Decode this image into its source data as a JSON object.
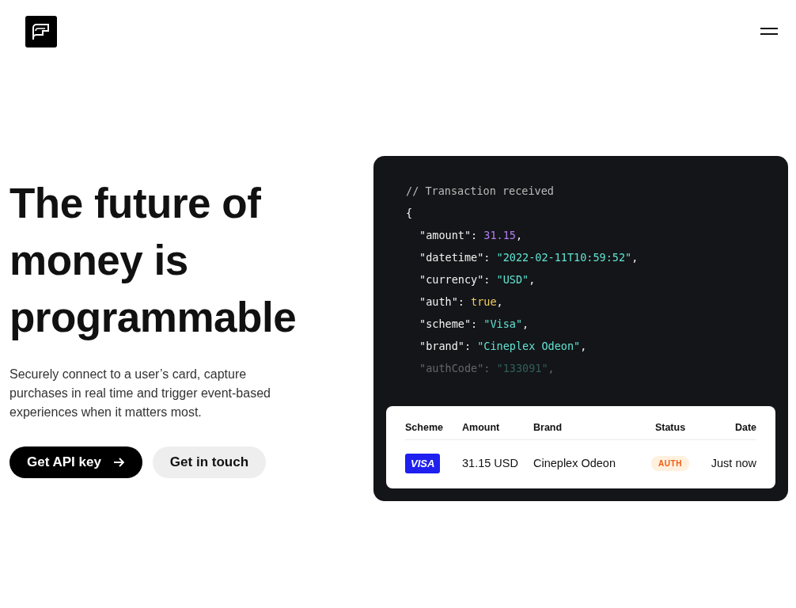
{
  "header": {
    "menu_open": false
  },
  "hero": {
    "heading": "The future of money is programmable",
    "description": "Securely connect to a user’s card, capture purchases in real time and trigger event-based experiences when it matters most.",
    "buttons": [
      {
        "label": "Get API key",
        "kind": "primary"
      },
      {
        "label": "Get in touch",
        "kind": "secondary"
      }
    ]
  },
  "code": {
    "comment": "// Transaction received",
    "open": "{",
    "fields": [
      {
        "key": "\"amount\":",
        "value": "31.15",
        "suffix": ",",
        "kind": "number",
        "faded": false
      },
      {
        "key": "\"datetime\":",
        "value": "\"2022-02-11T10:59:52\"",
        "suffix": ",",
        "kind": "string",
        "faded": false
      },
      {
        "key": "\"currency\":",
        "value": "\"USD\"",
        "suffix": ",",
        "kind": "string",
        "faded": false
      },
      {
        "key": "\"auth\":",
        "value": "true",
        "suffix": ",",
        "kind": "boolean",
        "faded": false
      },
      {
        "key": "\"scheme\":",
        "value": "\"Visa\"",
        "suffix": ",",
        "kind": "string",
        "faded": false
      },
      {
        "key": "\"brand\":",
        "value": "\"Cineplex Odeon\"",
        "suffix": ",",
        "kind": "string",
        "faded": false
      },
      {
        "key": "\"authCode\":",
        "value": "\"133091\"",
        "suffix": ",",
        "kind": "string",
        "faded": true
      }
    ]
  },
  "table": {
    "columns": [
      "Scheme",
      "Amount",
      "Brand",
      "Status",
      "Date"
    ],
    "rows": [
      {
        "scheme": "VISA",
        "amount": "31.15 USD",
        "brand": "Cineplex Odeon",
        "status": "AUTH",
        "date": "Just now"
      }
    ]
  }
}
